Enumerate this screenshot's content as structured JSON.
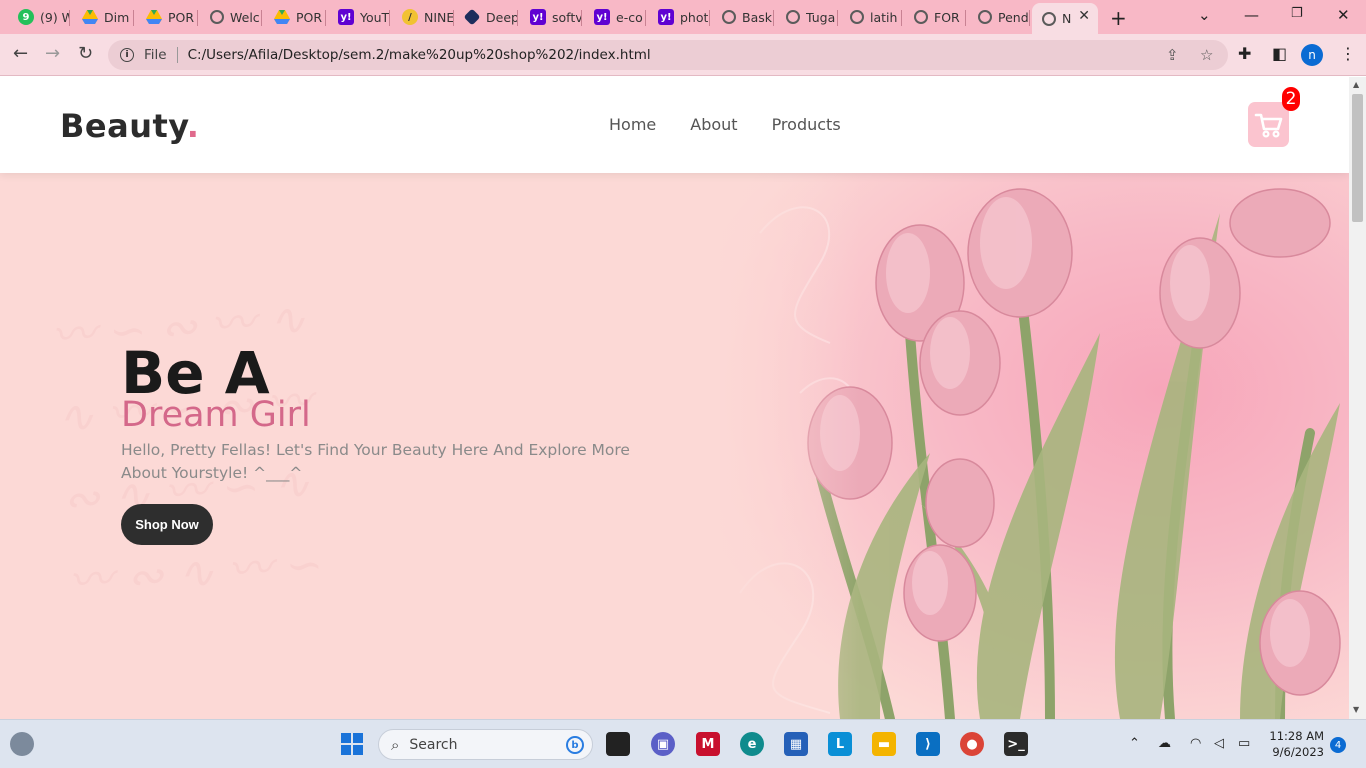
{
  "browser": {
    "tabs": [
      {
        "title": "(9) W",
        "icon": "whatsapp-icon"
      },
      {
        "title": "Dim",
        "icon": "drive-icon"
      },
      {
        "title": "POR",
        "icon": "drive-icon"
      },
      {
        "title": "Welc",
        "icon": "globe-icon"
      },
      {
        "title": "POR",
        "icon": "drive-icon"
      },
      {
        "title": "YouT",
        "icon": "yahoo-icon"
      },
      {
        "title": "NINE",
        "icon": "nine-icon"
      },
      {
        "title": "Deep",
        "icon": "deepl-icon"
      },
      {
        "title": "softv",
        "icon": "yahoo-icon"
      },
      {
        "title": "e-co",
        "icon": "yahoo-icon"
      },
      {
        "title": "phot",
        "icon": "yahoo-icon"
      },
      {
        "title": "Bask",
        "icon": "globe-icon"
      },
      {
        "title": "Tuga",
        "icon": "globe-icon"
      },
      {
        "title": "latih",
        "icon": "globe-icon"
      },
      {
        "title": "FOR",
        "icon": "globe-icon"
      },
      {
        "title": "Pend",
        "icon": "globe-icon"
      },
      {
        "title": "N",
        "icon": "globe-icon",
        "active": true
      }
    ],
    "address": {
      "scheme_label": "File",
      "url": "C:/Users/Afila/Desktop/sem.2/make%20up%20shop%202/index.html"
    },
    "profile_initial": "n",
    "colors": {
      "tabstrip": "#f8b8c6",
      "toolbar": "#f8dde3"
    }
  },
  "site": {
    "logo": {
      "text": "Beauty",
      "dot": "."
    },
    "nav": [
      "Home",
      "About",
      "Products"
    ],
    "cart": {
      "count": "2",
      "icon": "cart-icon"
    },
    "hero": {
      "title_line1": "Be A",
      "title_line2": "Dream Girl",
      "description": "Hello, Pretty Fellas! Let's Find Your Beauty Here And Explore More About Yourstyle! ^___^",
      "cta": "Shop Now",
      "image": "pink-tulips-image"
    },
    "colors": {
      "accent": "#e06a8c",
      "hero_bg": "#fcd9d6",
      "button": "#2e2e2e"
    }
  },
  "taskbar": {
    "search_placeholder": "Search",
    "time": "11:28 AM",
    "date": "9/6/2023",
    "notifications": "4"
  }
}
